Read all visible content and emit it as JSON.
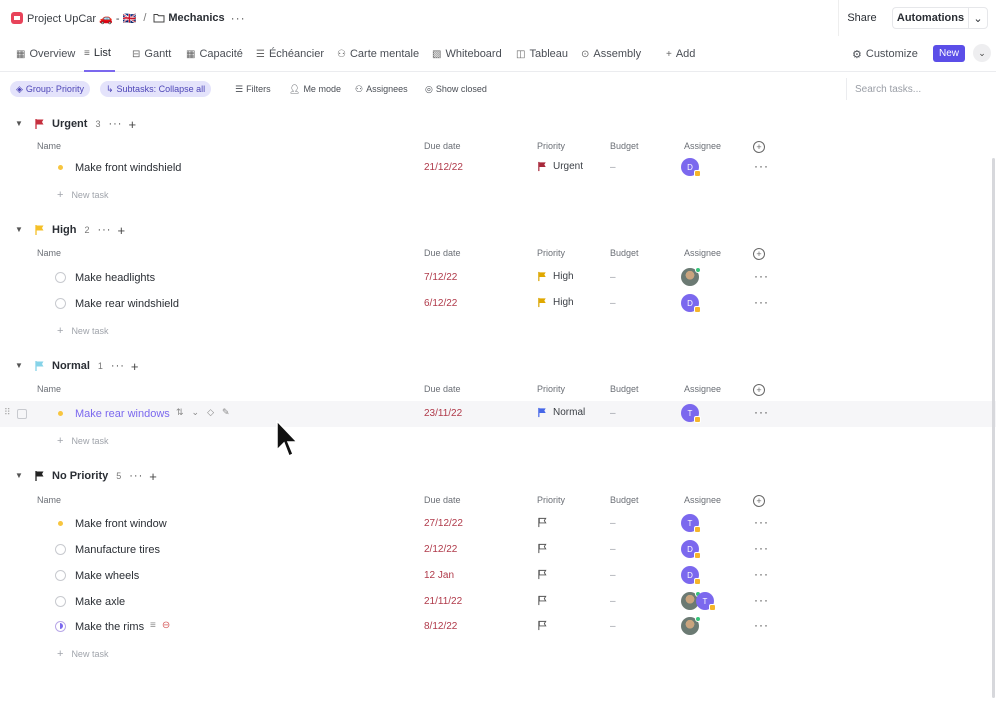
{
  "breadcrumb": {
    "project": "Project UpCar 🚗 - 🇬🇧",
    "separator": "/",
    "folder": "Mechanics",
    "more": "···"
  },
  "topbar": {
    "share": "Share",
    "automations": "Automations",
    "automations_chevron": "⌄"
  },
  "views": {
    "tabs": [
      {
        "label": "Overview",
        "icon": "▦"
      },
      {
        "label": "List",
        "icon": "≡"
      },
      {
        "label": "Gantt",
        "icon": "⊟"
      },
      {
        "label": "Capacité",
        "icon": "▦"
      },
      {
        "label": "Échéancier",
        "icon": "☰"
      },
      {
        "label": "Carte mentale",
        "icon": "⚇"
      },
      {
        "label": "Whiteboard",
        "icon": "▧"
      },
      {
        "label": "Tableau",
        "icon": "◫"
      },
      {
        "label": "Assembly",
        "icon": "⊙"
      },
      {
        "label": "Add",
        "icon": "+"
      }
    ],
    "customize": "Customize",
    "new": "New"
  },
  "filters": {
    "group": "Group: Priority",
    "subtasks": "Subtasks: Collapse all",
    "filters": "Filters",
    "me_mode": "Me mode",
    "assignees": "Assignees",
    "show_closed": "Show closed",
    "search_placeholder": "Search tasks..."
  },
  "columns": {
    "name": "Name",
    "due": "Due date",
    "priority": "Priority",
    "budget": "Budget",
    "assignee": "Assignee"
  },
  "new_task": "New task",
  "groups": [
    {
      "name": "Urgent",
      "count": "3",
      "flag_color": "#c62f3e",
      "tasks": [
        {
          "name": "Make front windshield",
          "status": "yellow",
          "due": "21/12/22",
          "priority": "Urgent",
          "prio_color": "#a8283a",
          "budget": "–",
          "assignee": "D"
        }
      ]
    },
    {
      "name": "High",
      "count": "2",
      "flag_color": "#f5c028",
      "tasks": [
        {
          "name": "Make headlights",
          "status": "empty",
          "due": "7/12/22",
          "priority": "High",
          "prio_color": "#e0a800",
          "budget": "–",
          "assignee": "photo"
        },
        {
          "name": "Make rear windshield",
          "status": "empty",
          "due": "6/12/22",
          "priority": "High",
          "prio_color": "#e0a800",
          "budget": "–",
          "assignee": "D"
        }
      ]
    },
    {
      "name": "Normal",
      "count": "1",
      "flag_color": "#86d3e8",
      "tasks": [
        {
          "name": "Make rear windows",
          "status": "yellow",
          "due": "23/11/22",
          "priority": "Normal",
          "prio_color": "#4667e8",
          "budget": "–",
          "assignee": "T"
        }
      ]
    },
    {
      "name": "No Priority",
      "count": "5",
      "flag_color": "#222222",
      "tasks": [
        {
          "name": "Make front window",
          "status": "yellow",
          "due": "27/12/22",
          "priority": "",
          "budget": "–",
          "assignee": "T"
        },
        {
          "name": "Manufacture tires",
          "status": "empty",
          "due": "2/12/22",
          "priority": "",
          "budget": "–",
          "assignee": "D"
        },
        {
          "name": "Make wheels",
          "status": "empty",
          "due": "12 Jan",
          "priority": "",
          "budget": "–",
          "assignee": "D"
        },
        {
          "name": "Make axle",
          "status": "empty",
          "due": "21/11/22",
          "priority": "",
          "budget": "–",
          "assignee": "photo+T"
        },
        {
          "name": "Make the rims",
          "status": "purple",
          "due": "8/12/22",
          "priority": "",
          "budget": "–",
          "assignee": "photo"
        }
      ]
    }
  ],
  "colors": {
    "accent": "#7b68ee",
    "due_text": "#b03a4a",
    "new_button": "#5b4ee8"
  }
}
